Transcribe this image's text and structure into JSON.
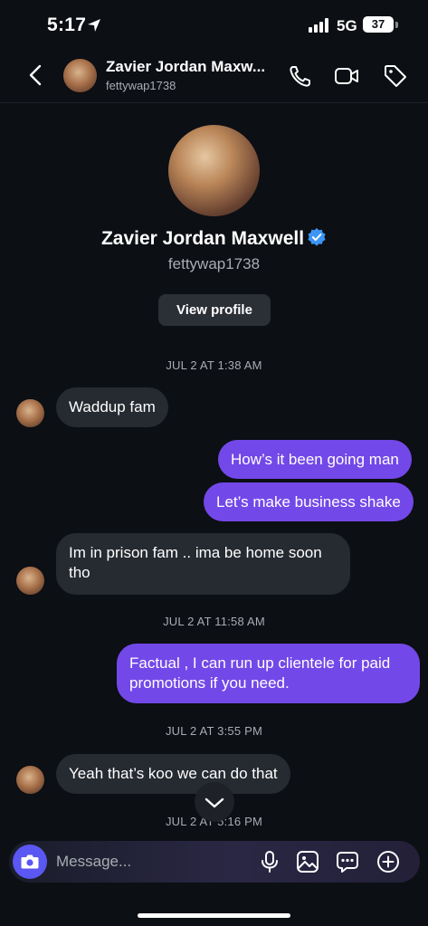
{
  "status_bar": {
    "time": "5:17",
    "network": "5G",
    "battery": "37"
  },
  "header": {
    "name": "Zavier Jordan Maxw...",
    "username": "fettywap1738"
  },
  "profile": {
    "name": "Zavier Jordan Maxwell",
    "username": "fettywap1738",
    "view_profile_label": "View profile"
  },
  "timestamps": [
    "JUL 2 AT 1:38 AM",
    "JUL 2 AT 11:58 AM",
    "JUL 2 AT 3:55 PM",
    "JUL 2 AT 5:16 PM"
  ],
  "messages": [
    {
      "from": "them",
      "text": "Waddup fam"
    },
    {
      "from": "me",
      "text": "How’s it been going man"
    },
    {
      "from": "me",
      "text": "Let’s make business shake"
    },
    {
      "from": "them",
      "text": "Im in prison fam .. ima be home soon tho"
    },
    {
      "from": "me",
      "text": "Factual , I can run up clientele for paid promotions if you need."
    },
    {
      "from": "them",
      "text": "Yeah that’s koo we can do that"
    }
  ],
  "composer": {
    "placeholder": "Message..."
  },
  "colors": {
    "background": "#0c0f14",
    "outgoing_bubble": "#7348e8",
    "incoming_bubble": "#262a31",
    "verified_badge": "#3d95f5",
    "camera_button": "#5b57f2"
  },
  "icons": [
    "back-icon",
    "phone-icon",
    "video-icon",
    "tag-icon",
    "verified-icon",
    "chevron-down-icon",
    "camera-icon",
    "microphone-icon",
    "gallery-icon",
    "sticker-icon",
    "plus-icon"
  ]
}
